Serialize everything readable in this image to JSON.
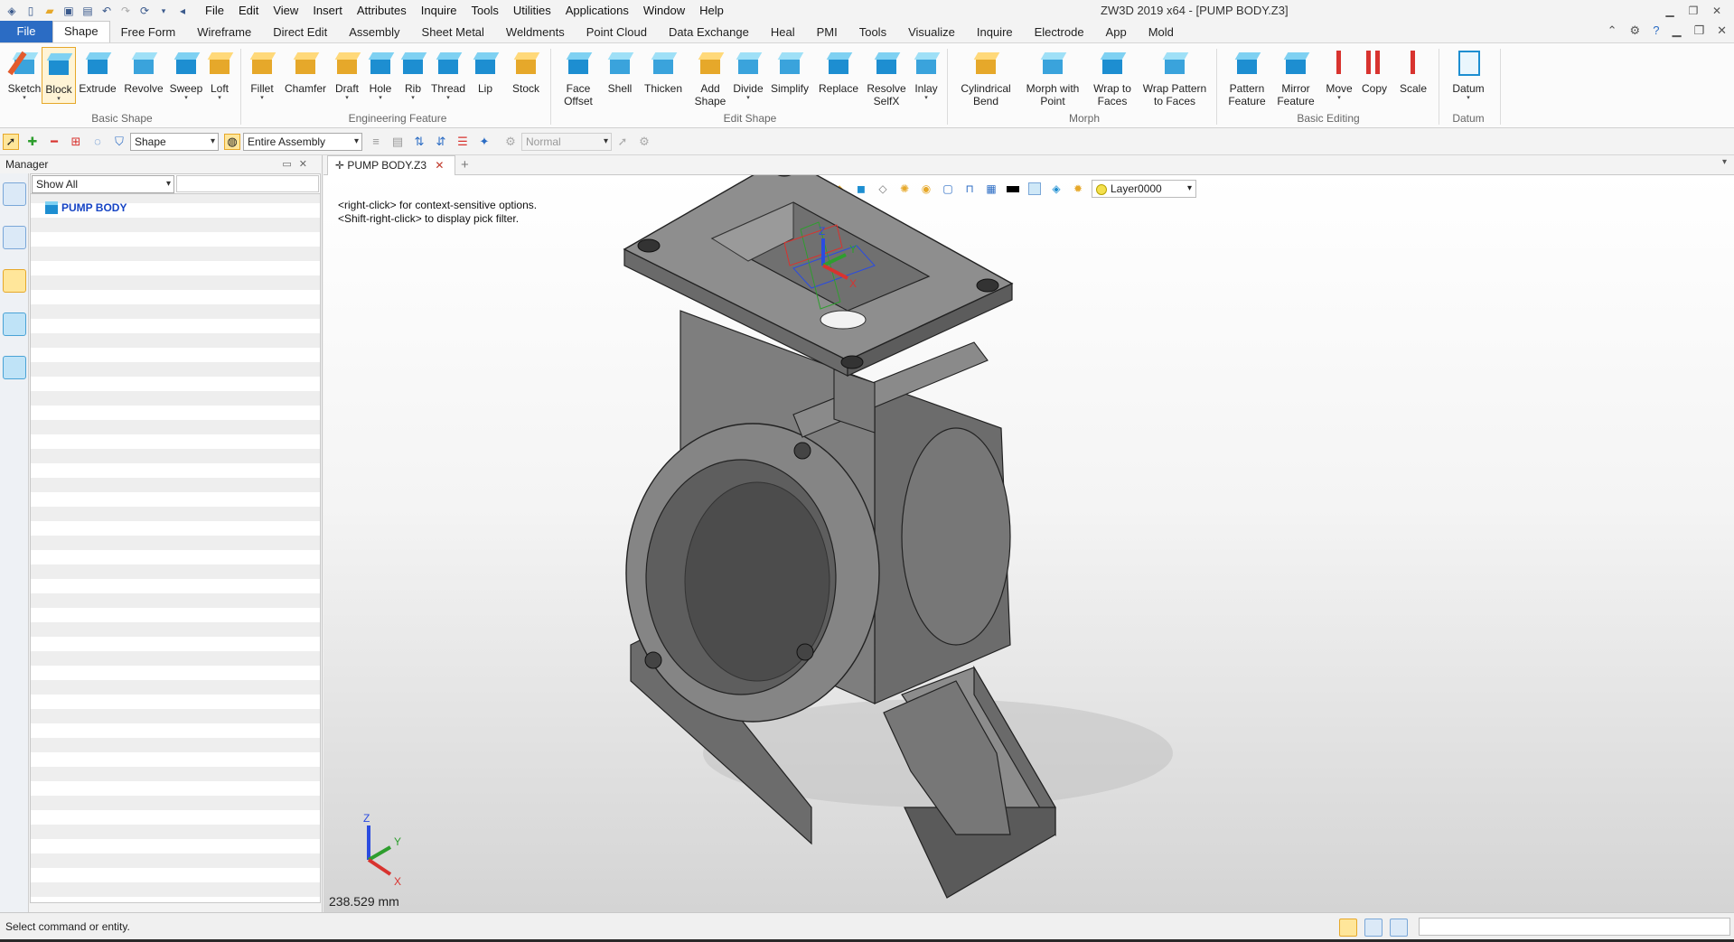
{
  "quick_access": [
    "app-logo-icon",
    "new-icon",
    "open-icon",
    "save-icon",
    "print-icon",
    "undo-icon",
    "redo-icon",
    "refresh-icon"
  ],
  "menu": [
    "File",
    "Edit",
    "View",
    "Insert",
    "Attributes",
    "Inquire",
    "Tools",
    "Utilities",
    "Applications",
    "Window",
    "Help"
  ],
  "app_title": "ZW3D 2019  x64 - [PUMP BODY.Z3]",
  "tabs": [
    "File",
    "Shape",
    "Free Form",
    "Wireframe",
    "Direct Edit",
    "Assembly",
    "Sheet Metal",
    "Weldments",
    "Point Cloud",
    "Data Exchange",
    "Heal",
    "PMI",
    "Tools",
    "Visualize",
    "Inquire",
    "Electrode",
    "App",
    "Mold"
  ],
  "active_tab": "Shape",
  "ribbon": {
    "groups": {
      "basic_shape": "Basic Shape",
      "engineering_feature": "Engineering Feature",
      "edit_shape": "Edit Shape",
      "morph": "Morph",
      "basic_editing": "Basic Editing",
      "datum": "Datum"
    },
    "buttons": {
      "sketch": "Sketch",
      "block": "Block",
      "extrude": "Extrude",
      "revolve": "Revolve",
      "sweep": "Sweep",
      "loft": "Loft",
      "fillet": "Fillet",
      "chamfer": "Chamfer",
      "draft": "Draft",
      "hole": "Hole",
      "rib": "Rib",
      "thread": "Thread",
      "lip": "Lip",
      "stock": "Stock",
      "face_offset_1": "Face",
      "face_offset_2": "Offset",
      "shell": "Shell",
      "thicken": "Thicken",
      "add_shape_1": "Add",
      "add_shape_2": "Shape",
      "divide": "Divide",
      "simplify": "Simplify",
      "replace": "Replace",
      "resolve_1": "Resolve",
      "resolve_2": "SelfX",
      "inlay": "Inlay",
      "cyl_bend_1": "Cylindrical",
      "cyl_bend_2": "Bend",
      "morph_point_1": "Morph with",
      "morph_point_2": "Point",
      "wrap_faces_1": "Wrap to",
      "wrap_faces_2": "Faces",
      "wrap_pattern_1": "Wrap Pattern",
      "wrap_pattern_2": "to Faces",
      "pattern_1": "Pattern",
      "pattern_2": "Feature",
      "mirror_1": "Mirror",
      "mirror_2": "Feature",
      "move": "Move",
      "copy": "Copy",
      "scale": "Scale",
      "datum": "Datum"
    }
  },
  "toolbar2": {
    "filter_value": "Shape",
    "scope_value": "Entire Assembly",
    "mode_value": "Normal"
  },
  "manager": {
    "title": "Manager",
    "filter": "Show All",
    "tree_root": "PUMP BODY"
  },
  "document_tab": "PUMP BODY.Z3",
  "viewport": {
    "hint_line1": "<right-click> for context-sensitive options.",
    "hint_line2": "<Shift-right-click> to display pick filter.",
    "layer": "Layer0000",
    "scale": "238.529 mm",
    "axis_x": "X",
    "axis_y": "Y",
    "axis_z": "Z"
  },
  "status": {
    "message": "Select command or entity."
  },
  "colors": {
    "accent": "#2b6cc4",
    "tree_text": "#1644c4",
    "model_gray": "#6e6e6e"
  }
}
